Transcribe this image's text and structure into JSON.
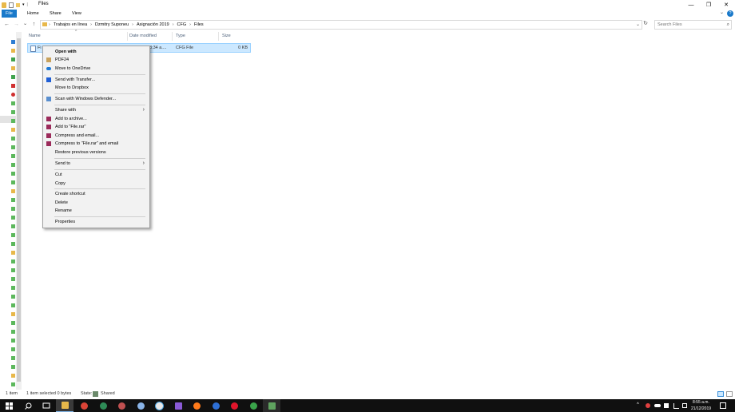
{
  "window": {
    "title": "Files",
    "minimize_icon": "—",
    "maximize_icon": "❐",
    "close_icon": "✕",
    "help_icon": "?",
    "expand_icon": "⌄"
  },
  "ribbon": {
    "tabs": [
      "File",
      "Home",
      "Share",
      "View"
    ]
  },
  "nav": {
    "back": "←",
    "forward": "→",
    "recent": "⌄",
    "up": "↑"
  },
  "address": {
    "crumbs": [
      "Trabajos en línea",
      "Dzmitry Suponeu",
      "Asignación 2019",
      "CFG",
      "Files"
    ],
    "sep": "›",
    "dropdown": "⌄",
    "refresh": "↻"
  },
  "search": {
    "placeholder": "Search Files",
    "icon": "⌕"
  },
  "columns": {
    "name": "Name",
    "date": "Date modified",
    "type": "Type",
    "size": "Size",
    "sort_indicator": "^"
  },
  "file": {
    "name_visible": "Fi",
    "date_visible": "8:34 a....",
    "type": "CFG File",
    "size": "0 KB"
  },
  "context_menu": {
    "open_with": "Open with",
    "pdf24": "PDF24",
    "onedrive": "Move to OneDrive",
    "transfer": "Send with Transfer...",
    "dropbox": "Move to Dropbox",
    "defender": "Scan with Windows Defender...",
    "share_with": "Share with",
    "add_archive": "Add to archive...",
    "add_rar": "Add to \"File.rar\"",
    "compress_email": "Compress and email...",
    "compress_rar_email": "Compress to \"File.rar\" and email",
    "restore": "Restore previous versions",
    "send_to": "Send to",
    "cut": "Cut",
    "copy": "Copy",
    "create_shortcut": "Create shortcut",
    "delete": "Delete",
    "rename": "Rename",
    "properties": "Properties",
    "submenu_arrow": "›"
  },
  "status": {
    "items": "1 item",
    "selected": "1 item selected  0 bytes",
    "state_label": "State:",
    "state_value": "Shared"
  },
  "tray": {
    "time": "8:55 a.m.",
    "date": "21/12/2019",
    "chevron": "^"
  },
  "colors": {
    "file_tab": "#1979ca",
    "selection": "#cce8ff",
    "taskbar": "#101010"
  }
}
